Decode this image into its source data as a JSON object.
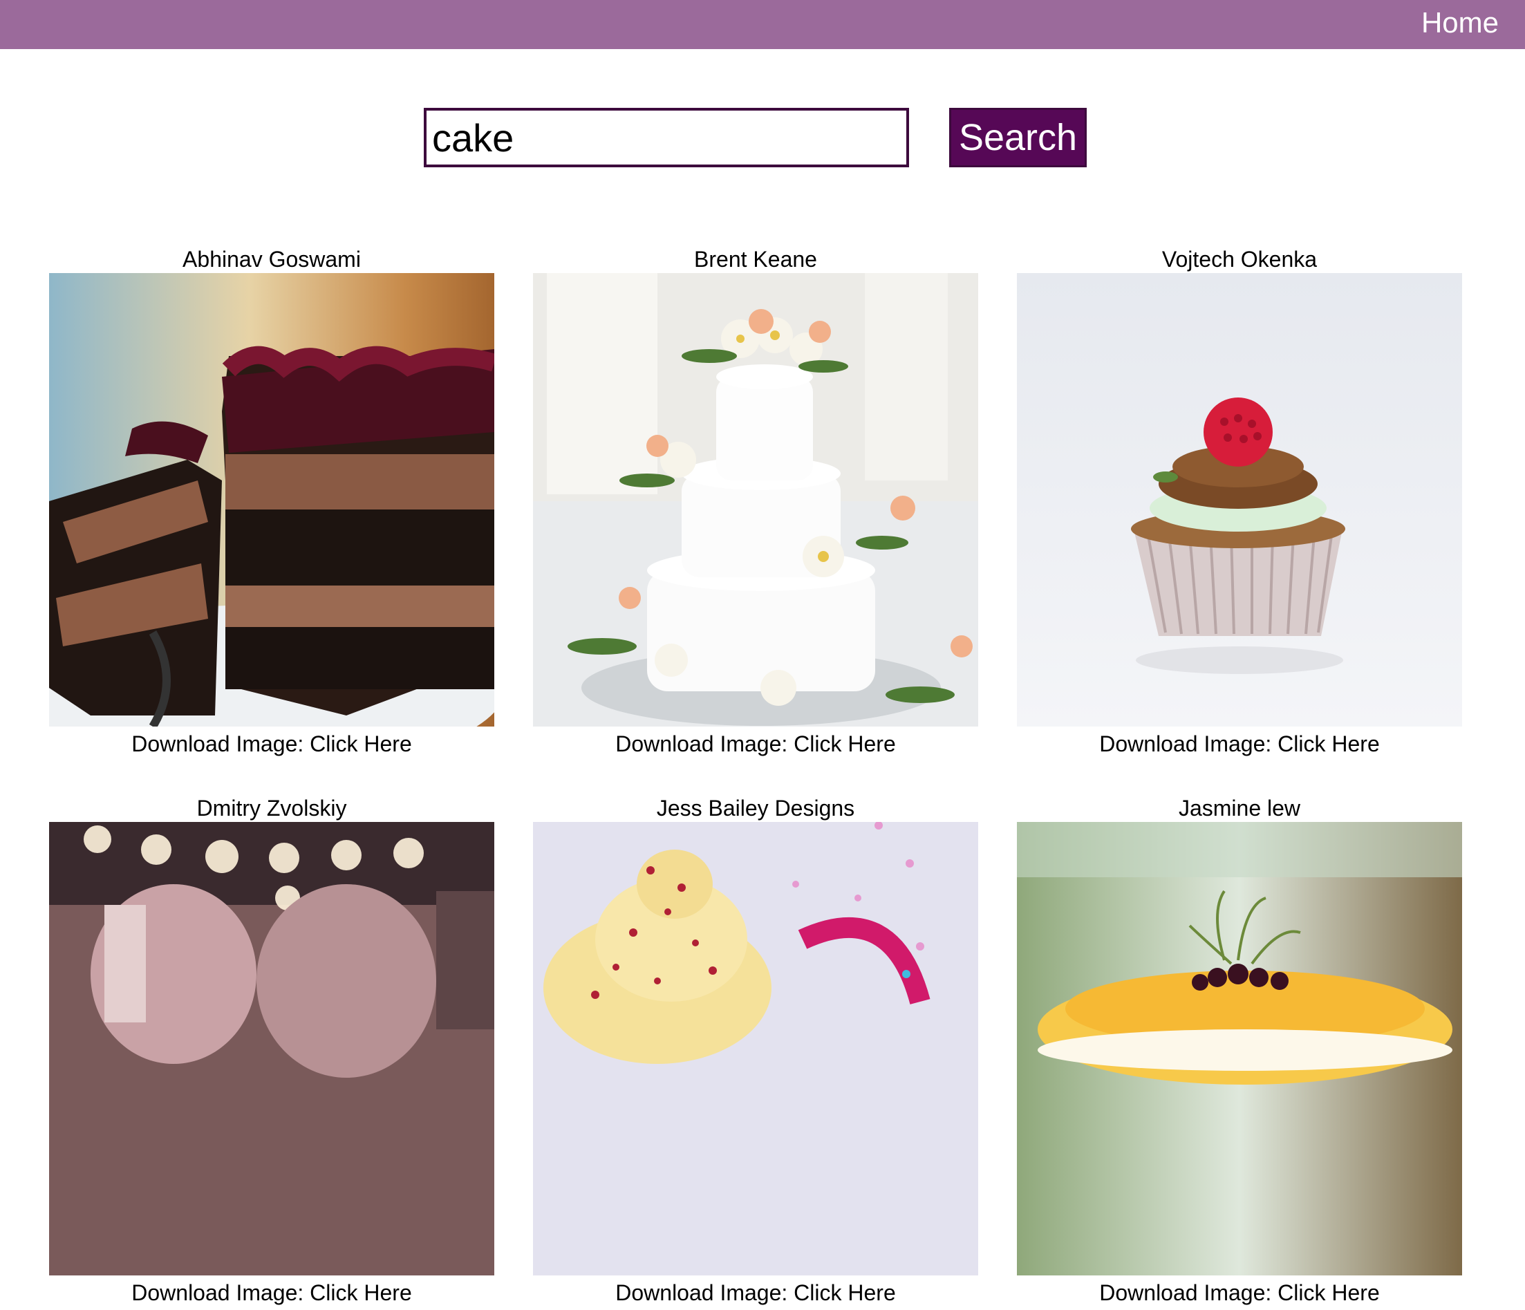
{
  "nav": {
    "home_label": "Home"
  },
  "search": {
    "value": "cake",
    "button_label": "Search"
  },
  "download_label": "Download Image: ",
  "download_link_label": "Click Here",
  "results": [
    {
      "author": "Abhinav Goswami"
    },
    {
      "author": "Brent Keane"
    },
    {
      "author": "Vojtech Okenka"
    },
    {
      "author": "Dmitry Zvolskiy"
    },
    {
      "author": "Jess Bailey Designs"
    },
    {
      "author": "Jasmine lew"
    }
  ],
  "colors": {
    "nav_bar": "#9b6a9b",
    "button_bg": "#560856",
    "input_border": "#3d0a3d"
  }
}
